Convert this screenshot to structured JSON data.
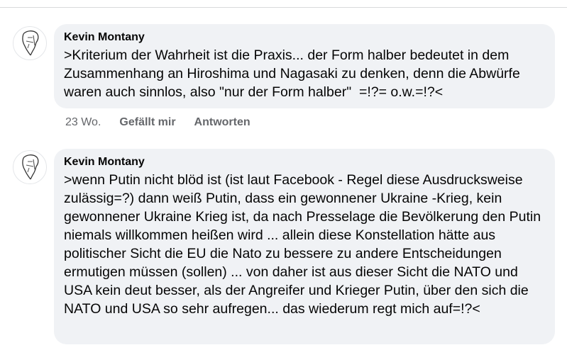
{
  "comments": [
    {
      "author": "Kevin Montany",
      "text": ">Kriterium der Wahrheit ist die Praxis... der Form halber bedeutet in dem Zusammenhang an Hiroshima und Nagasaki zu denken, denn die Abwürfe waren auch sinnlos, also \"nur der Form halber\"  =!?= o.w.=!?<",
      "time": "23 Wo.",
      "like_label": "Gefällt mir",
      "reply_label": "Antworten"
    },
    {
      "author": "Kevin Montany",
      "text": ">wenn Putin nicht blöd ist (ist laut Facebook - Regel diese Ausdrucksweise zulässig=?) dann weiß Putin, dass ein gewonnener Ukraine -Krieg, kein gewonnener Ukraine Krieg ist, da nach Presselage die Bevölkerung den Putin niemals willkommen heißen wird ... allein diese Konstellation hätte aus politischer Sicht die EU die Nato zu bessere zu andere Entscheidungen ermutigen müssen (sollen) ... von daher ist aus dieser Sicht die NATO und USA kein deut besser, als der Angreifer und Krieger Putin, über den sich die NATO und USA so sehr aufregen... das wiederum regt mich auf=!?<"
    }
  ],
  "icons": {
    "avatar": "profile-sketch-avatar"
  }
}
